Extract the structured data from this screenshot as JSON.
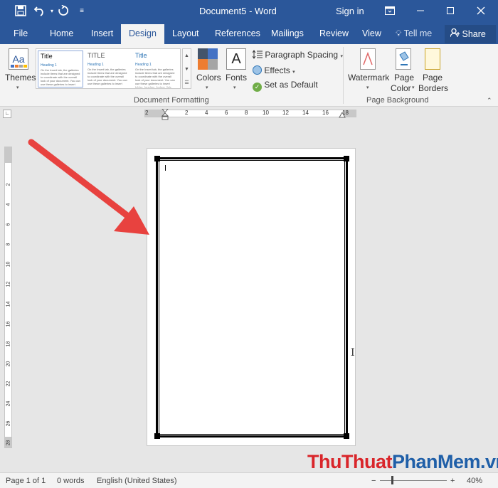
{
  "title_bar": {
    "document_title": "Document5  -  Word",
    "signin": "Sign in"
  },
  "tabs": [
    "File",
    "Home",
    "Insert",
    "Design",
    "Layout",
    "References",
    "Mailings",
    "Review",
    "View"
  ],
  "active_tab": "Design",
  "tellme": "Tell me",
  "share": "Share",
  "ribbon": {
    "themes_label": "Themes",
    "style_sets": [
      {
        "title": "Title",
        "heading": "Heading 1",
        "body": "On the Insert tab, the galleries include items that are designed to coordinate with the overall look of your document. You can use these galleries to insert"
      },
      {
        "title": "TITLE",
        "heading": "Heading 1",
        "body": "On the Insert tab, the galleries include items that are designed to coordinate with the overall look of your document. You can use these galleries to insert"
      },
      {
        "title": "Title",
        "heading": "Heading 1",
        "body": "On the Insert tab, the galleries include items that are designed to coordinate with the overall look of your document. You can use these galleries to insert tables, headers, footers, lists, cover pages, and other document building blocks."
      }
    ],
    "colors_label": "Colors",
    "fonts_label": "Fonts",
    "fonts_icon_letter": "A",
    "paragraph_spacing": "Paragraph Spacing",
    "effects": "Effects",
    "set_as_default": "Set as Default",
    "document_formatting_label": "Document Formatting",
    "watermark_label": "Watermark",
    "page_color_label_1": "Page",
    "page_color_label_2": "Color",
    "page_borders_label_1": "Page",
    "page_borders_label_2": "Borders",
    "page_background_label": "Page Background"
  },
  "ruler": {
    "horizontal": [
      "2",
      "2",
      "4",
      "6",
      "8",
      "10",
      "12",
      "14",
      "16",
      "18"
    ],
    "vertical": [
      "2",
      "4",
      "6",
      "8",
      "10",
      "12",
      "14",
      "16",
      "18",
      "20",
      "22",
      "24",
      "26",
      "28"
    ]
  },
  "status_bar": {
    "page": "Page 1 of 1",
    "words": "0 words",
    "language": "English (United States)",
    "zoom": "40%",
    "zoom_out": "−",
    "zoom_in": "+"
  },
  "watermark_text": {
    "part1": "ThuThuat",
    "part2": "PhanMem",
    "part3": ".vn"
  },
  "colors": {
    "word_blue": "#2b579a",
    "arrow_red": "#e8423f",
    "logo_red": "#d9252a",
    "logo_blue": "#1f5fa8"
  }
}
